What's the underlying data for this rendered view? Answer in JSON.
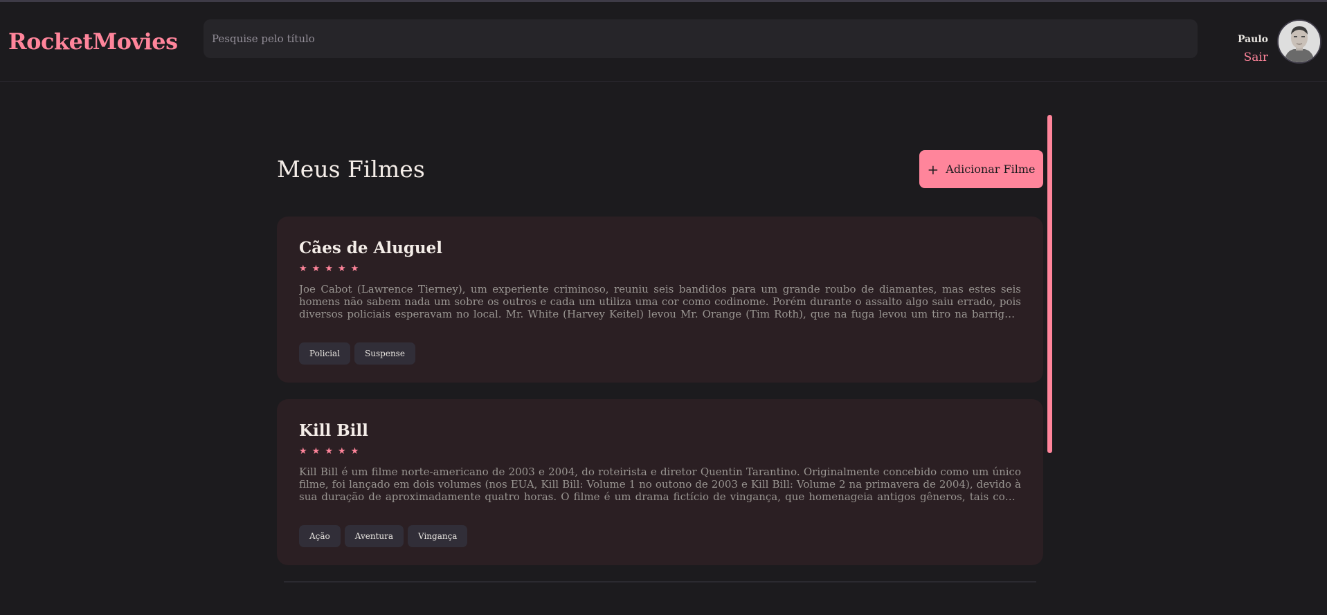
{
  "header": {
    "brand": "RocketMovies",
    "search_placeholder": "Pesquise pelo título",
    "user": {
      "name": "Paulo",
      "logout": "Sair"
    }
  },
  "main": {
    "title": "Meus Filmes",
    "add_button": {
      "icon": "plus-icon",
      "symbol": "+",
      "label": "Adicionar Filme"
    },
    "movies": [
      {
        "title": "Cães de Aluguel",
        "rating": 5,
        "synopsis": "Joe Cabot (Lawrence Tierney), um experiente criminoso, reuniu seis bandidos para um grande roubo de diamantes, mas estes seis homens não sabem nada um sobre os outros e cada um utiliza uma cor como codinome. Porém durante o assalto algo saiu errado, pois diversos policiais esperavam no local. Mr. White (Harvey Keitel) levou Mr. Orange (Tim Roth), que na fuga levou um tiro na barriga e morrerá se n...",
        "tags": [
          "Policial",
          "Suspense"
        ]
      },
      {
        "title": "Kill Bill",
        "rating": 5,
        "synopsis": "Kill Bill é um filme norte-americano de 2003 e 2004, do roteirista e diretor Quentin Tarantino. Originalmente concebido como um único filme, foi lançado em dois volumes (nos EUA, Kill Bill: Volume 1 no outono de 2003 e Kill Bill: Volume 2 na primavera de 2004), devido à sua duração de aproximadamente quatro horas. O filme é um drama fictício de vingança, que homenageia antigos gêneros, tais como film...",
        "tags": [
          "Ação",
          "Aventura",
          "Vingança"
        ]
      }
    ]
  },
  "colors": {
    "accent": "#ff859b",
    "background": "#1c1b1e",
    "card": "#2b1f23",
    "tag": "#312e38"
  }
}
